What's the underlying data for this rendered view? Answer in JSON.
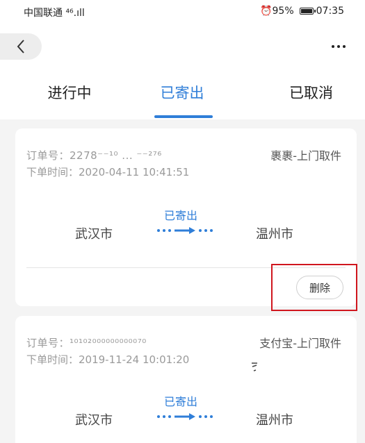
{
  "status_bar": {
    "carrier": "中国联通 ⁴⁶.ıll",
    "right": "⏰95%",
    "time": "07:35"
  },
  "nav": {
    "back_icon": "chevron-left-icon",
    "more_icon": "more-horizontal-icon"
  },
  "tabs": [
    {
      "label": "进行中",
      "active": false
    },
    {
      "label": "已寄出",
      "active": true
    },
    {
      "label": "已取消",
      "active": false
    }
  ],
  "orders": [
    {
      "order_no": "订单号：2278⁻⁻¹⁰ ... ⁻⁻²⁷⁶",
      "order_time": "下单时间：2020-04-11 10:41:51",
      "type": "裹裹-上门取件",
      "status": "已寄出",
      "from_city": "武汉市",
      "to_city": "温州市",
      "action_label": "删除"
    },
    {
      "order_no": "订单号：¹⁰¹⁰²⁰⁰⁰⁰⁰⁰⁰⁰⁰⁰⁷⁰",
      "order_time": "下单时间：2019-11-24 10:01:20",
      "type": "支付宝-上门取件",
      "status": "已寄出",
      "from_city": "武汉市",
      "to_city": "温州市"
    }
  ],
  "colors": {
    "accent": "#2f7ed8",
    "highlight": "#d0161e",
    "background": "#f4f4f4"
  }
}
